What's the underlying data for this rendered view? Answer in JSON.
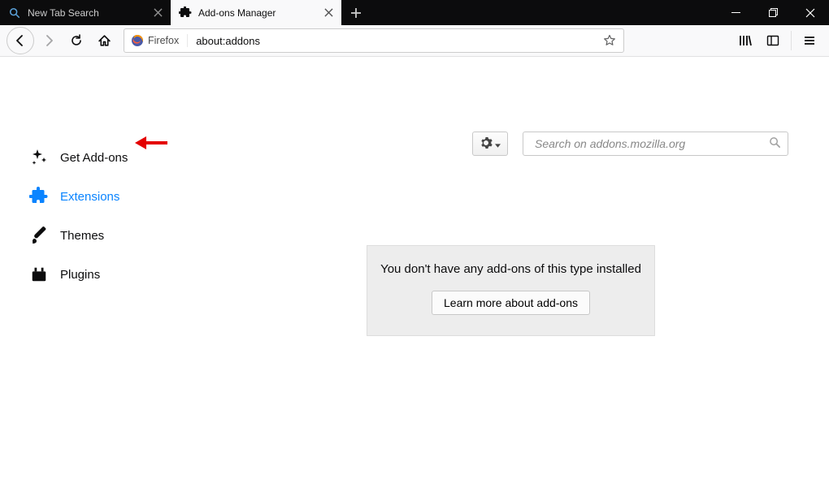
{
  "titlebar": {
    "tabs": [
      {
        "label": "New Tab Search",
        "active": false
      },
      {
        "label": "Add-ons Manager",
        "active": true
      }
    ]
  },
  "urlbar": {
    "identity_label": "Firefox",
    "url": "about:addons"
  },
  "sidebar": {
    "items": [
      {
        "label": "Get Add-ons"
      },
      {
        "label": "Extensions"
      },
      {
        "label": "Themes"
      },
      {
        "label": "Plugins"
      }
    ]
  },
  "search": {
    "placeholder": "Search on addons.mozilla.org"
  },
  "empty_state": {
    "message": "You don't have any add-ons of this type installed",
    "button": "Learn more about add-ons"
  }
}
